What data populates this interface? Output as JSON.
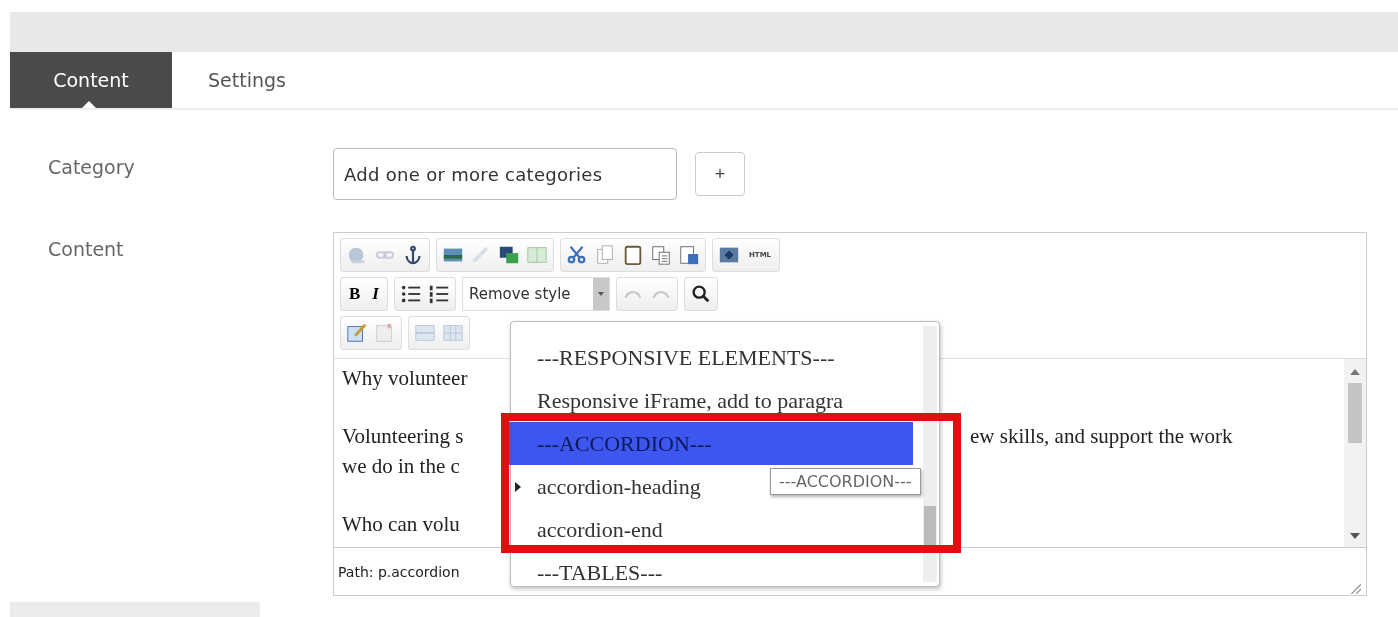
{
  "tabs": [
    {
      "label": "Content",
      "selected": true
    },
    {
      "label": "Settings",
      "selected": false
    }
  ],
  "category": {
    "label": "Category",
    "placeholder": "Add one or more categories",
    "add_button": "+"
  },
  "content": {
    "label": "Content",
    "toolbar": {
      "bold": "B",
      "italic": "I",
      "html": "HTML",
      "style_select": "Remove style"
    },
    "body": [
      {
        "left": "Why volunteer"
      },
      {
        "left": "Volunteering s",
        "right": "ew skills, and support the work"
      },
      {
        "left": "we do in the c"
      },
      {
        "left": "Who can volu"
      }
    ],
    "path": "Path: p.accordion",
    "style_menu": {
      "items": [
        {
          "label": "---RESPONSIVE ELEMENTS---",
          "selected": false,
          "submenu": false
        },
        {
          "label": "Responsive iFrame, add to paragra",
          "selected": false,
          "submenu": false
        },
        {
          "label": "---ACCORDION---",
          "selected": true,
          "submenu": false
        },
        {
          "label": "accordion-heading",
          "selected": false,
          "submenu": true
        },
        {
          "label": "accordion-end",
          "selected": false,
          "submenu": false
        },
        {
          "label": "---TABLES---",
          "selected": false,
          "submenu": false
        }
      ],
      "tooltip": "---ACCORDION---"
    }
  }
}
